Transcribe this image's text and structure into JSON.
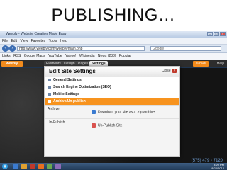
{
  "slide_title": "PUBLISHING…",
  "browser": {
    "window_title": "Weebly - Website Creation Made Easy",
    "window_controls": [
      "–",
      "□",
      "×"
    ],
    "menu": [
      "File",
      "Edit",
      "View",
      "Favorites",
      "Tools",
      "Help"
    ],
    "url": "http://www.weebly.com/weebly/main.php",
    "search_placeholder": "Google",
    "links": [
      "Links",
      "RSS",
      "Google Maps",
      "YouTube",
      "Yahoo!",
      "Wikipedia",
      "News (238)",
      "Popular"
    ]
  },
  "app": {
    "logo": "weebly",
    "tabs": [
      "Elements",
      "Design",
      "Pages",
      "Settings"
    ],
    "publish_label": "Publish",
    "help_label": "Help"
  },
  "modal": {
    "title": "Edit Site Settings",
    "close_label": "Close",
    "menu": [
      "General Settings",
      "Search Engine Optimization (SEO)",
      "Mobile Settings",
      "Archive/Un-publish"
    ],
    "archive_label": "Archive",
    "archive_action": "Download your site as a .zip archive.",
    "unpublish_label": "Un-Publish",
    "unpublish_action": "Un-Publish Site."
  },
  "background": {
    "phone": "(575) 479 - 7120"
  },
  "taskbar": {
    "time": "8:20 PM",
    "date": "8/22/2012"
  },
  "colors": {
    "accent": "#f7931e",
    "screen_bg": "#1f3550",
    "taskbar": "#213a57"
  }
}
